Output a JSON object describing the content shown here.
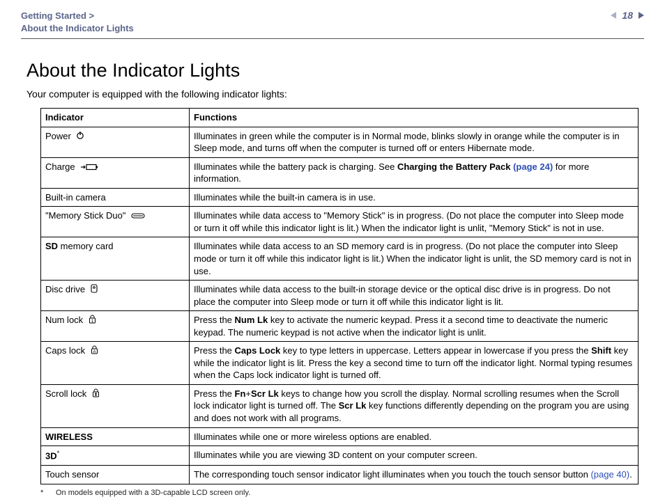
{
  "breadcrumb": {
    "section": "Getting Started >",
    "page": "About the Indicator Lights"
  },
  "page_number": "18",
  "title": "About the Indicator Lights",
  "intro": "Your computer is equipped with the following indicator lights:",
  "table": {
    "head": {
      "c1": "Indicator",
      "c2": "Functions"
    },
    "rows": {
      "power": {
        "name": "Power",
        "func": "Illuminates in green while the computer is in Normal mode, blinks slowly in orange while the computer is in Sleep mode, and turns off when the computer is turned off or enters Hibernate mode."
      },
      "charge": {
        "name": "Charge",
        "func_a": "Illuminates while the battery pack is charging. See ",
        "func_bold": "Charging the Battery Pack ",
        "func_link": "(page 24)",
        "func_b": " for more information."
      },
      "camera": {
        "name": "Built-in camera",
        "func": "Illuminates while the built-in camera is in use."
      },
      "msduo": {
        "name": "\"Memory Stick Duo\"",
        "func": "Illuminates while data access to \"Memory Stick\" is in progress. (Do not place the computer into Sleep mode or turn it off while this indicator light is lit.) When the indicator light is unlit, \"Memory Stick\" is not in use."
      },
      "sd": {
        "name_bold": "SD",
        "name_rest": " memory card",
        "func": "Illuminates while data access to an SD memory card is in progress. (Do not place the computer into Sleep mode or turn it off while this indicator light is lit.) When the indicator light is unlit, the SD memory card is not in use."
      },
      "disc": {
        "name": "Disc drive",
        "func": "Illuminates while data access to the built-in storage device or the optical disc drive is in progress. Do not place the computer into Sleep mode or turn it off while this indicator light is lit."
      },
      "numlk": {
        "name": "Num lock",
        "func_a": "Press the ",
        "func_bold": "Num Lk",
        "func_b": " key to activate the numeric keypad. Press it a second time to deactivate the numeric keypad. The numeric keypad is not active when the indicator light is unlit."
      },
      "capslk": {
        "name": "Caps lock",
        "func_a": "Press the ",
        "func_bold1": "Caps Lock",
        "func_b": " key to type letters in uppercase. Letters appear in lowercase if you press the ",
        "func_bold2": "Shift",
        "func_c": " key while the indicator light is lit. Press the key a second time to turn off the indicator light. Normal typing resumes when the Caps lock indicator light is turned off."
      },
      "scrlk": {
        "name": "Scroll lock",
        "func_a": "Press the ",
        "func_bold1": "Fn",
        "func_plus": "+",
        "func_bold2": "Scr Lk",
        "func_b": " keys to change how you scroll the display. Normal scrolling resumes when the Scroll lock indicator light is turned off. The ",
        "func_bold3": "Scr Lk",
        "func_c": " key functions differently depending on the program you are using and does not work with all programs."
      },
      "wireless": {
        "name": "WIRELESS",
        "func": "Illuminates while one or more wireless options are enabled."
      },
      "threed": {
        "name": "3D",
        "sup": "*",
        "func": "Illuminates while you are viewing 3D content on your computer screen."
      },
      "touch": {
        "name": "Touch sensor",
        "func_a": "The corresponding touch sensor indicator light illuminates when you touch the touch sensor button ",
        "func_link": "(page 40)",
        "func_b": "."
      }
    }
  },
  "footnote": {
    "star": "*",
    "text": "On models equipped with a 3D-capable LCD screen only."
  }
}
